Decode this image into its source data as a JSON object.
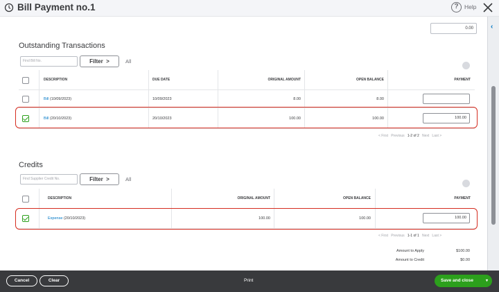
{
  "header": {
    "title": "Bill Payment no.1",
    "help_label": "Help"
  },
  "amount_field": {
    "value": "0.00"
  },
  "outstanding": {
    "section_title": "Outstanding Transactions",
    "find_placeholder": "Find Bill No.",
    "filter_label": "Filter",
    "filter_caret": ">",
    "all_label": "All",
    "columns": [
      "DESCRIPTION",
      "DUE DATE",
      "ORIGINAL AMOUNT",
      "OPEN BALANCE",
      "PAYMENT"
    ],
    "rows": [
      {
        "checked": false,
        "link": "Bill",
        "date_suffix": "(10/09/2023)",
        "due_date": "10/09/2023",
        "original_amount": "8.00",
        "open_balance": "8.00",
        "payment": ""
      },
      {
        "checked": true,
        "link": "Bill",
        "date_suffix": "(20/10/2023)",
        "due_date": "20/10/2023",
        "original_amount": "100.00",
        "open_balance": "100.00",
        "payment": "100.00"
      }
    ],
    "pager": {
      "first": "< First",
      "previous": "Previous",
      "current": "1-2 of 2",
      "next": "Next",
      "last": "Last >"
    }
  },
  "credits": {
    "section_title": "Credits",
    "find_placeholder": "Find Supplier Credit No.",
    "filter_label": "Filter",
    "filter_caret": ">",
    "all_label": "All",
    "columns": [
      "DESCRIPTION",
      "ORIGINAL AMOUNT",
      "OPEN BALANCE",
      "PAYMENT"
    ],
    "rows": [
      {
        "checked": true,
        "link": "Expense",
        "date_suffix": "(20/10/2023)",
        "original_amount": "100.00",
        "open_balance": "100.00",
        "payment": "100.00"
      }
    ],
    "pager": {
      "first": "< First",
      "previous": "Previous",
      "current": "1-1 of 1",
      "next": "Next",
      "last": "Last >"
    }
  },
  "summary": {
    "amount_to_apply_label": "Amount to Apply",
    "amount_to_apply_value": "$100.00",
    "amount_to_credit_label": "Amount to Credit",
    "amount_to_credit_value": "$0.00"
  },
  "footer": {
    "cancel_label": "Cancel",
    "clear_label": "Clear",
    "print_label": "Print",
    "save_label": "Save and close",
    "save_caret": "▾"
  },
  "colors": {
    "accent_green": "#2ca01c",
    "link_blue": "#0077c5",
    "highlight_red": "#d52b1e",
    "footer_bg": "#393a3d"
  },
  "icons": [
    "history-icon",
    "help-icon",
    "close-icon",
    "collapse-icon",
    "gear-icon",
    "checkbox-icon"
  ]
}
